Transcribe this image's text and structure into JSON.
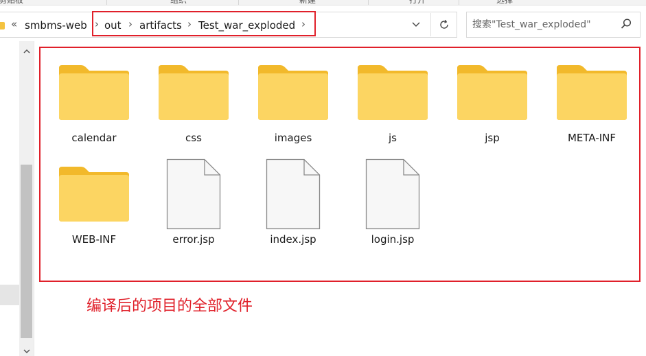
{
  "ribbon": {
    "groups": [
      "剪贴板",
      "组织",
      "新建",
      "打开",
      "选择"
    ]
  },
  "address_bar": {
    "overflow_symbol": "«",
    "crumbs": [
      "smbms-web",
      "out",
      "artifacts",
      "Test_war_exploded"
    ]
  },
  "search": {
    "placeholder": "搜索\"Test_war_exploded\""
  },
  "items": [
    {
      "name": "calendar",
      "type": "folder"
    },
    {
      "name": "css",
      "type": "folder"
    },
    {
      "name": "images",
      "type": "folder"
    },
    {
      "name": "js",
      "type": "folder"
    },
    {
      "name": "jsp",
      "type": "folder"
    },
    {
      "name": "META-INF",
      "type": "folder"
    },
    {
      "name": "WEB-INF",
      "type": "folder"
    },
    {
      "name": "error.jsp",
      "type": "file"
    },
    {
      "name": "index.jsp",
      "type": "file"
    },
    {
      "name": "login.jsp",
      "type": "file"
    }
  ],
  "annotation": {
    "caption": "编译后的项目的全部文件",
    "color": "#e0202a"
  },
  "colors": {
    "folder_back": "#f2b92b",
    "folder_front": "#fcd562",
    "annotation": "#e0202a"
  }
}
